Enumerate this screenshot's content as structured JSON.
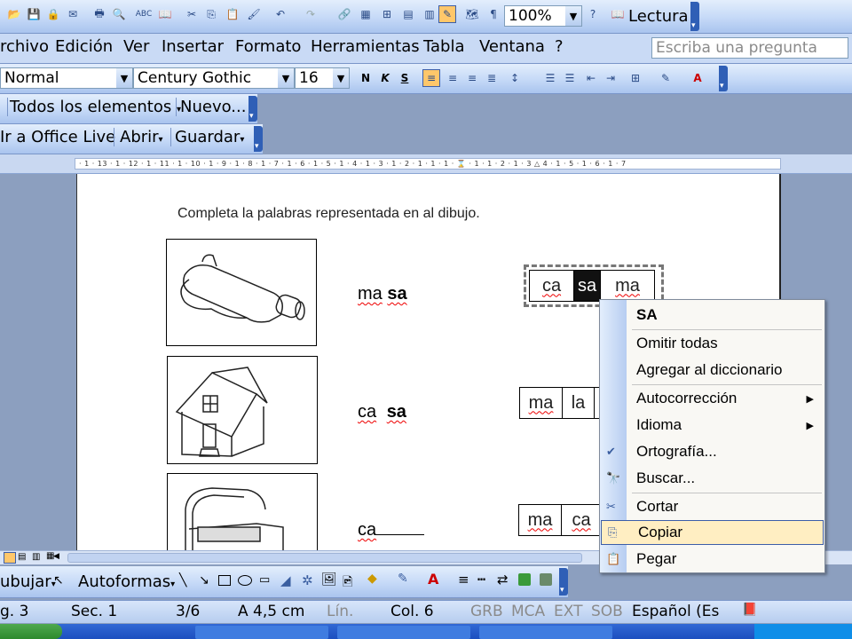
{
  "toolbar": {
    "zoom": "100%",
    "reading_label": "Lectura"
  },
  "menu": {
    "items": [
      "rchivo",
      "Edición",
      "Ver",
      "Insertar",
      "Formato",
      "Herramientas",
      "Tabla",
      "Ventana",
      "?"
    ],
    "ask_placeholder": "Escriba una pregunta"
  },
  "format": {
    "style": "Normal",
    "font": "Century Gothic",
    "size": "16",
    "bold": "N",
    "italic": "K",
    "underline": "S"
  },
  "bar3": {
    "all_elements": "Todos los elementos",
    "new": "Nuevo..."
  },
  "bar4": {
    "office_live": "Ir a Office Live",
    "open": "Abrir",
    "save": "Guardar"
  },
  "ruler": {
    "ticks": "· 1 · 13 · 1 · 12 · 1 · 11 · 1 · 10 · 1 · 9 · 1 · 8 · 1 · 7 · 1 · 6 · 1 · 5 · 1 · 4 · 1 · 3 · 1 · 2 · 1 · 1 · 1 · ⌛ · 1 · 1 · 2 · 1 · 3 △ 4 · 1 · 5 · 1 · 6 · 1 · 7"
  },
  "doc": {
    "instruction": "Completa la palabras representada en al dibujo.",
    "row1": {
      "a": "ma",
      "b": "sa"
    },
    "row2": {
      "a": "ca",
      "b": "sa"
    },
    "row3": {
      "a": "ca"
    },
    "boxes1": [
      "ca",
      "sa",
      "ma"
    ],
    "boxes2": [
      "ma",
      "la"
    ],
    "boxes3": [
      "ma",
      "ca"
    ]
  },
  "context_menu": {
    "suggestion": "SA",
    "ignore_all": "Omitir todas",
    "add_dict": "Agregar al diccionario",
    "autocorrect": "Autocorrección",
    "language": "Idioma",
    "spelling": "Ortografía...",
    "find": "Buscar...",
    "cut": "Cortar",
    "copy": "Copiar",
    "paste": "Pegar"
  },
  "drawing": {
    "draw": "ubujar",
    "autoshapes": "Autoformas"
  },
  "status": {
    "page": "g. 3",
    "section": "Sec. 1",
    "pages": "3/6",
    "at": "A 4,5 cm",
    "line": "Lín.",
    "col": "Col. 6",
    "rec": "GRB",
    "trk": "MCA",
    "ext": "EXT",
    "ovr": "SOB",
    "lang": "Español (Es"
  },
  "colors": {
    "toolbar_bg": "#c5d9f7",
    "highlight": "#ffeec2",
    "page_bg": "#ffffff",
    "app_bg": "#8c9fbf"
  }
}
